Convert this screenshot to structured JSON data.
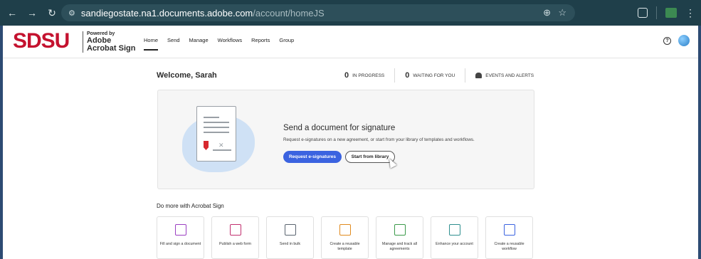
{
  "browser": {
    "url_host": "sandiegostate.na1.documents.adobe.com",
    "url_path": "/account/homeJS"
  },
  "header": {
    "logo": "SDSU",
    "powered_by": "Powered by",
    "product_line1": "Adobe",
    "product_line2": "Acrobat Sign",
    "nav": [
      "Home",
      "Send",
      "Manage",
      "Workflows",
      "Reports",
      "Group"
    ],
    "active_nav": "Home"
  },
  "dashboard": {
    "welcome": "Welcome, Sarah",
    "in_progress_count": "0",
    "in_progress_label": "IN PROGRESS",
    "waiting_count": "0",
    "waiting_label": "WAITING FOR YOU",
    "alerts_label": "EVENTS AND ALERTS"
  },
  "hero": {
    "title": "Send a document for signature",
    "subtitle": "Request e-signatures on a new agreement, or start from your library of templates and workflows.",
    "primary_button": "Request e-signatures",
    "secondary_button": "Start from library"
  },
  "do_more": {
    "heading": "Do more with Acrobat Sign",
    "tiles": [
      {
        "label": "Fill and sign a document",
        "icon": "fill-sign-icon",
        "color": "#9b3fc2"
      },
      {
        "label": "Publish a web form",
        "icon": "web-form-icon",
        "color": "#c2306f"
      },
      {
        "label": "Send in bulk",
        "icon": "send-bulk-icon",
        "color": "#5a6470"
      },
      {
        "label": "Create a reusable template",
        "icon": "template-icon",
        "color": "#e08a1e"
      },
      {
        "label": "Manage and track all agreements",
        "icon": "manage-track-icon",
        "color": "#3b9a4a"
      },
      {
        "label": "Enhance your account",
        "icon": "enhance-account-icon",
        "color": "#2f8f8f"
      },
      {
        "label": "Create a reusable workflow",
        "icon": "workflow-icon",
        "color": "#3b63e0"
      }
    ]
  }
}
